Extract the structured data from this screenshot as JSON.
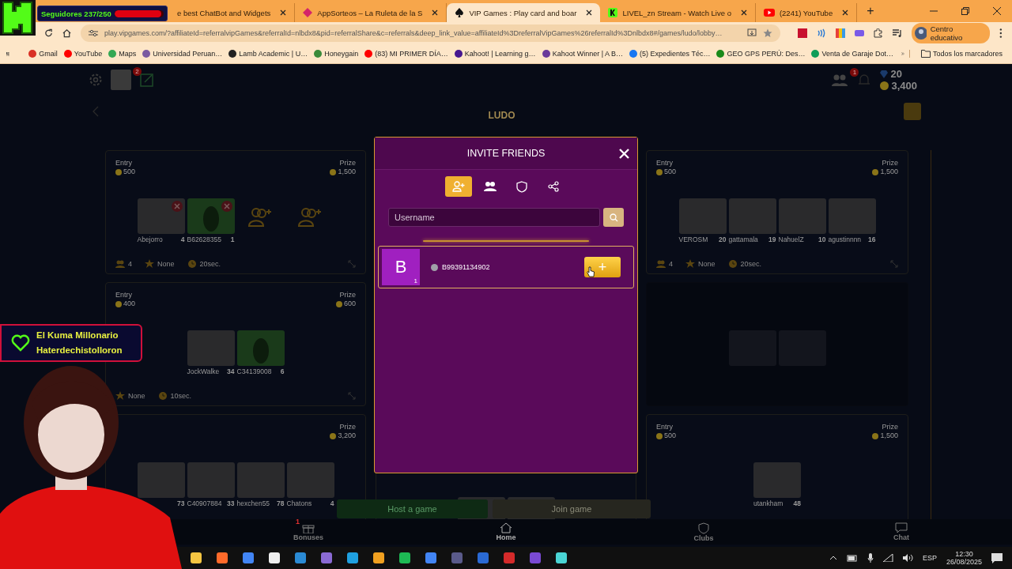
{
  "stream_overlay": {
    "follower_goal": {
      "label": "Seguidores 237/250",
      "level": 0.95
    },
    "alert": {
      "lines": [
        "El Kuma Millonario",
        "Haterdechistolloron"
      ]
    }
  },
  "browser": {
    "tabs": [
      {
        "title": "e best ChatBot and Widgets",
        "kind": "none",
        "selected": false
      },
      {
        "title": "AppSorteos – La Ruleta de la S",
        "kind": "diamond",
        "selected": false
      },
      {
        "title": "VIP Games : Play card and boar",
        "kind": "spade",
        "selected": true
      },
      {
        "title": "LIVEL_zn Stream - Watch Live o",
        "kind": "square",
        "selected": false
      },
      {
        "title": "(2241) YouTube",
        "kind": "play",
        "selected": false
      }
    ],
    "new_tab": "+",
    "url": "play.vipgames.com/?affiliateId=referralvipGames&referralId=nlbdx8&pid=referralShare&c=referrals&deep_link_value=affiliateId%3DreferralVipGames%26referralId%3Dnlbdx8#/games/ludo/lobby…",
    "profile": "Centro educativo",
    "bookmarks": [
      {
        "label": "Gmail",
        "color": "#d93025"
      },
      {
        "label": "YouTube",
        "color": "#ff0000"
      },
      {
        "label": "Maps",
        "color": "#34a853"
      },
      {
        "label": "Universidad Peruan…",
        "color": "#7a5aa0"
      },
      {
        "label": "Lamb Academic | U…",
        "color": "#222222"
      },
      {
        "label": "Honeygain",
        "color": "#3a8a3a"
      },
      {
        "label": "(83) MI PRIMER DÍA…",
        "color": "#ff0000"
      },
      {
        "label": "Kahoot! | Learning g…",
        "color": "#46178f"
      },
      {
        "label": "Kahoot Winner | A B…",
        "color": "#6a3a9a"
      },
      {
        "label": "(5) Expedientes Téc…",
        "color": "#1877f2"
      },
      {
        "label": "GEO GPS PERÚ: Des…",
        "color": "#1a8a1a"
      },
      {
        "label": "Venta de Garaje Dot…",
        "color": "#0f9d58"
      }
    ],
    "all_bookmarks": "Todos los marcadores"
  },
  "game": {
    "header": {
      "edit_badge": "2",
      "notification_badge": "1",
      "gems": "20",
      "coins": "3,400",
      "logo": "LUDO"
    },
    "columns": [
      {
        "tables": [
          {
            "entry": {
              "label": "Entry",
              "value": "500"
            },
            "prize": {
              "label": "Prize",
              "value": "1,500"
            },
            "faded": false,
            "players": [
              {
                "kind": "photo",
                "name": "Abejorro",
                "level": "4",
                "removable": true
              },
              {
                "kind": "silhouette",
                "name": "B62628355",
                "level": "1",
                "removable": true
              },
              {
                "kind": "empty"
              },
              {
                "kind": "empty"
              }
            ],
            "footer": {
              "count": "4",
              "mode": "None",
              "timer": "20sec."
            }
          },
          {
            "entry": {
              "label": "Entry",
              "value": "400"
            },
            "prize": {
              "label": "Prize",
              "value": "600"
            },
            "faded": false,
            "players": [
              {
                "kind": "photo",
                "name": "JockWalke",
                "level": "34",
                "removable": false
              },
              {
                "kind": "silhouette",
                "name": "C34139008",
                "level": "6",
                "removable": false
              }
            ],
            "footer": {
              "mode": "None",
              "timer": "10sec."
            }
          },
          {
            "prize": {
              "label": "Prize",
              "value": "3,200"
            },
            "faded": false,
            "players": [
              {
                "kind": "photo",
                "level": "73",
                "removable": false
              },
              {
                "kind": "photo",
                "name": "C40907884",
                "level": "33",
                "removable": false
              },
              {
                "kind": "photo",
                "name": "hexchen55",
                "level": "78",
                "removable": false
              },
              {
                "kind": "photo",
                "name": "Chatons",
                "level": "4",
                "removable": false
              }
            ]
          }
        ]
      },
      {
        "tables": [
          {
            "faded": false,
            "players": [
              {
                "kind": "photo"
              },
              {
                "kind": "photo"
              }
            ]
          }
        ]
      },
      {
        "tables": [
          {
            "entry": {
              "label": "Entry",
              "value": "500"
            },
            "prize": {
              "label": "Prize",
              "value": "1,500"
            },
            "faded": false,
            "players": [
              {
                "kind": "photo",
                "name": "VEROSM",
                "level": "20",
                "removable": false
              },
              {
                "kind": "photo",
                "name": "gattamala",
                "level": "19",
                "removable": false
              },
              {
                "kind": "photo",
                "name": "NahuelZ",
                "level": "10",
                "removable": false
              },
              {
                "kind": "photo",
                "name": "agustinnnn",
                "level": "16",
                "removable": false
              }
            ],
            "footer": {
              "count": "4",
              "mode": "None",
              "timer": "20sec."
            }
          },
          {
            "faded": true,
            "players": [
              {
                "kind": "photo",
                "removable": false
              },
              {
                "kind": "photo",
                "removable": false
              }
            ]
          },
          {
            "entry": {
              "label": "Entry",
              "value": "500"
            },
            "prize": {
              "label": "Prize",
              "value": "1,500"
            },
            "faded": false,
            "players": [
              {
                "kind": "photo",
                "name": "utankham",
                "level": "48",
                "removable": false
              }
            ]
          }
        ]
      }
    ],
    "host_button": "Host a game",
    "join_button": "Join game",
    "nav": [
      {
        "label": "Bonuses",
        "kind": "gift",
        "badge": "1",
        "selected": false
      },
      {
        "label": "Home",
        "kind": "home",
        "selected": true
      },
      {
        "label": "Clubs",
        "kind": "shield",
        "selected": false
      },
      {
        "label": "Chat",
        "kind": "chat",
        "selected": false
      }
    ]
  },
  "invite_dialog": {
    "title": "INVITE FRIENDS",
    "tabs": [
      {
        "kind": "add-user",
        "selected": true
      },
      {
        "kind": "users",
        "selected": false
      },
      {
        "kind": "shield",
        "selected": false
      },
      {
        "kind": "share",
        "selected": false
      }
    ],
    "search": {
      "placeholder": "Username"
    },
    "friends": [
      {
        "initial": "B",
        "level": "1",
        "name": "B99391134902",
        "online": false,
        "add_label": "+"
      }
    ]
  },
  "taskbar": {
    "language": "ESP",
    "time": "12:30",
    "date": "26/08/2025"
  }
}
